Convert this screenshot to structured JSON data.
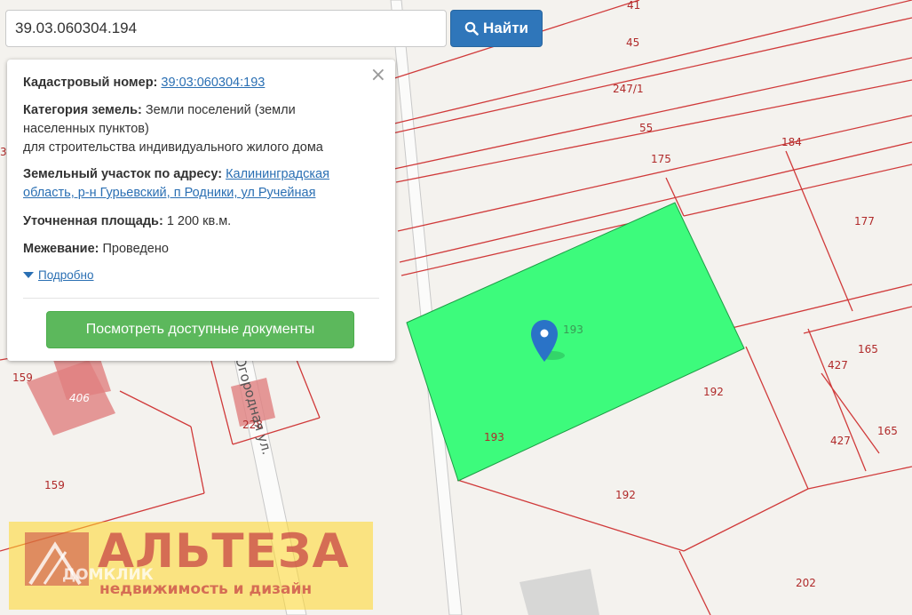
{
  "search": {
    "value": "39.03.060304.194",
    "button_label": "Найти"
  },
  "popup": {
    "close_label": "×",
    "cadastral_label": "Кадастровый номер:",
    "cadastral_value": "39:03:060304:193",
    "category_label": "Категория земель:",
    "category_value": "Земли поселений (земли населенных пунктов)",
    "category_value_line2": "для строительства индивидуального жилого дома",
    "address_label": "Земельный участок по адресу:",
    "address_value": "Калининградская область, р-н Гурьевский, п Родники, ул Ручейная",
    "area_label": "Уточненная площадь:",
    "area_value": "1 200 кв.м.",
    "survey_label": "Межевание:",
    "survey_value": "Проведено",
    "more_label": "Подробно",
    "docs_button": "Посмотреть доступные документы"
  },
  "map": {
    "street_label": "Огородная ул.",
    "parcel_labels": [
      "41",
      "45",
      "247/1",
      "55",
      "184",
      "175",
      "177",
      "193",
      "193",
      "192",
      "192",
      "165",
      "427",
      "165",
      "427",
      "159",
      "406",
      "159",
      "228",
      "202",
      "3"
    ],
    "colors": {
      "parcel_line": "#d03a3a",
      "selected_fill": "#3dfb7c",
      "marker": "#2a73c7",
      "building": "#e07f80"
    }
  },
  "watermark": {
    "brand": "АЛЬТЕЗА",
    "tagline": "недвижимость и дизайн",
    "source": "ДОМКЛИК"
  }
}
